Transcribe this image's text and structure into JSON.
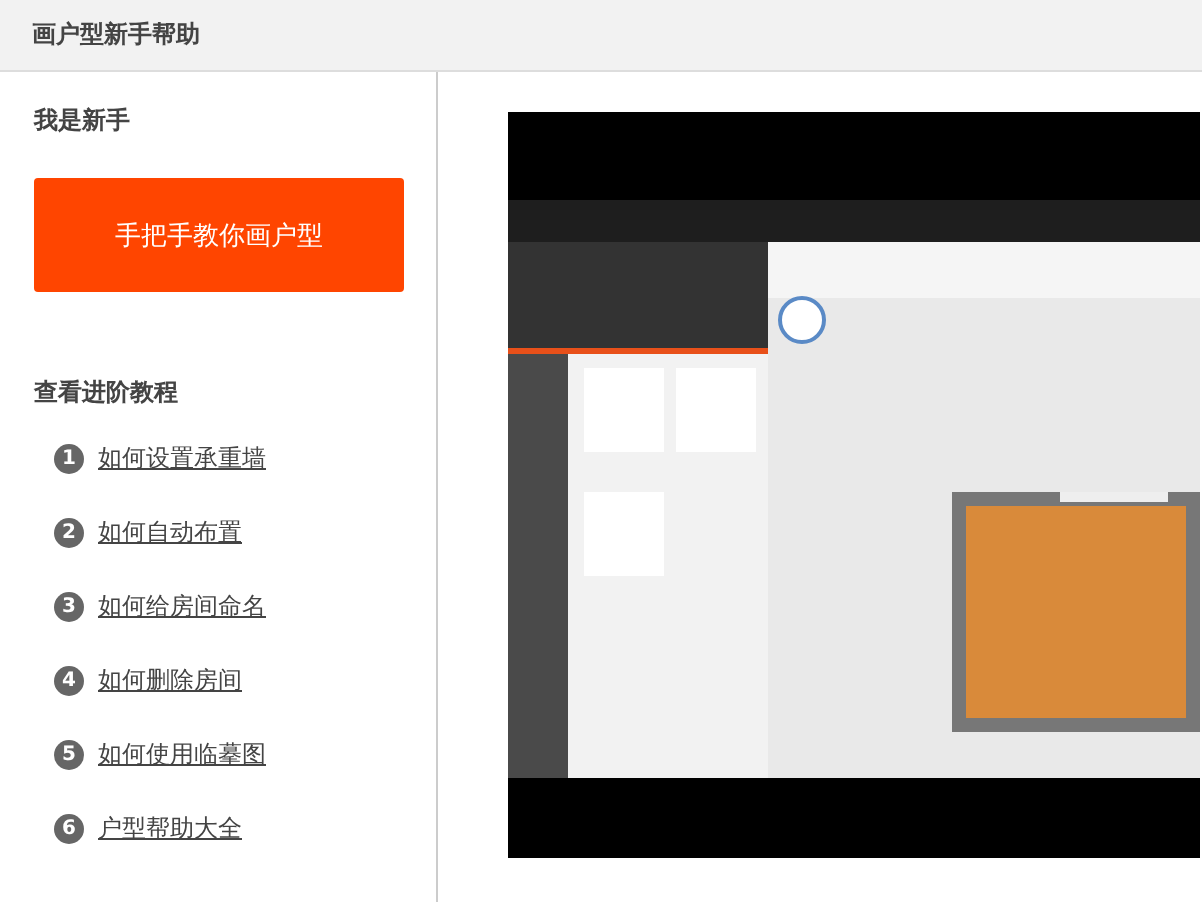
{
  "window": {
    "title": "画户型新手帮助"
  },
  "newbie": {
    "heading": "我是新手",
    "button": "手把手教你画户型"
  },
  "advanced": {
    "heading": "查看进阶教程",
    "tutorials": [
      {
        "number": "1",
        "label": "如何设置承重墙"
      },
      {
        "number": "2",
        "label": "如何自动布置"
      },
      {
        "number": "3",
        "label": "如何给房间命名"
      },
      {
        "number": "4",
        "label": "如何删除房间"
      },
      {
        "number": "5",
        "label": "如何使用临摹图"
      },
      {
        "number": "6",
        "label": "户型帮助大全"
      }
    ]
  }
}
